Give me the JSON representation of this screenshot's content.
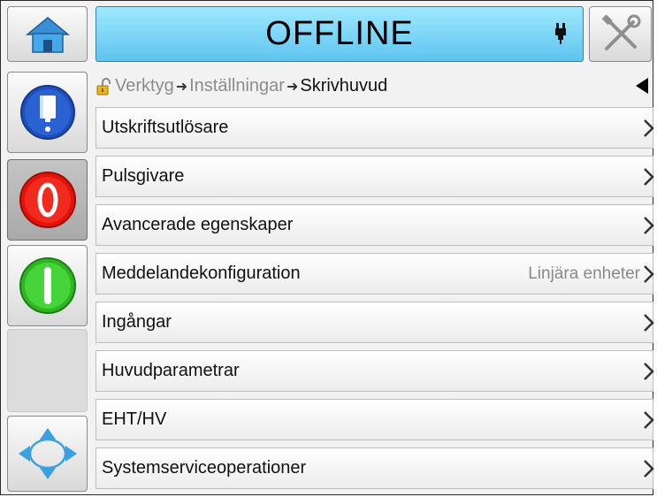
{
  "header": {
    "status": "OFFLINE",
    "status_color": "#6ccff5"
  },
  "breadcrumb": {
    "items": [
      "Verktyg",
      "Inställningar"
    ],
    "current": "Skrivhuvud"
  },
  "menu": {
    "items": [
      {
        "label": "Utskriftsutlösare",
        "value": ""
      },
      {
        "label": "Pulsgivare",
        "value": ""
      },
      {
        "label": "Avancerade egenskaper",
        "value": ""
      },
      {
        "label": "Meddelandekonfiguration",
        "value": "Linjära enheter"
      },
      {
        "label": "Ingångar",
        "value": ""
      },
      {
        "label": "Huvudparametrar",
        "value": ""
      },
      {
        "label": "EHT/HV",
        "value": ""
      },
      {
        "label": "Systemserviceoperationer",
        "value": ""
      }
    ]
  },
  "icons": {
    "home": "home-icon",
    "tools": "tools-icon",
    "printhead": "printhead-status-icon",
    "ink": "ink-bottle-icon",
    "stop": "stop-icon",
    "start": "start-icon",
    "navigate": "navigation-arrows-icon"
  }
}
